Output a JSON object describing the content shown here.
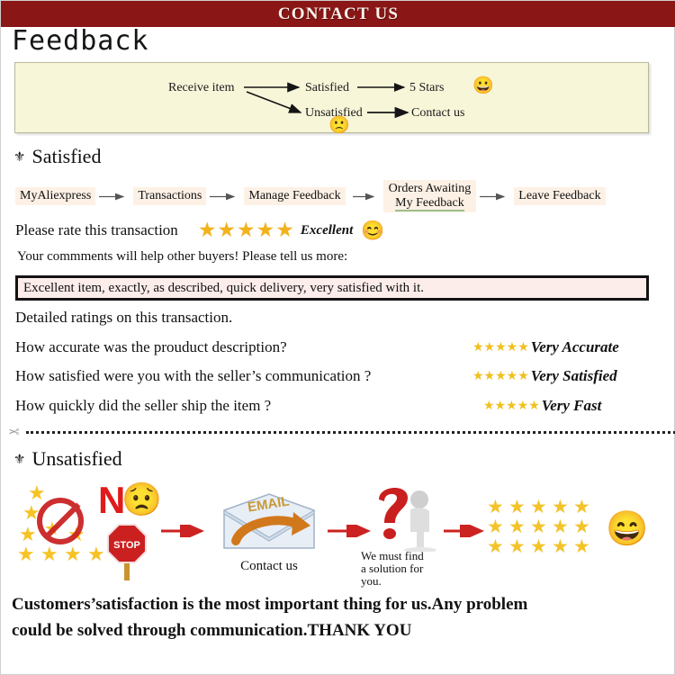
{
  "banner": {
    "title": "CONTACT US"
  },
  "heading": {
    "feedback": "Feedback"
  },
  "flow": {
    "receive_item": "Receive item",
    "satisfied": "Satisfied",
    "five_stars": "5 Stars",
    "unsatisfied": "Unsatisfied",
    "contact_us": "Contact us",
    "happy_face": "😀",
    "sad_face": "🙁"
  },
  "satisfied": {
    "bullet": "⚜",
    "title": "Satisfied",
    "crumbs": [
      {
        "label": "MyAliexpress"
      },
      {
        "label": "Transactions"
      },
      {
        "label": "Manage Feedback"
      },
      {
        "line1": "Orders Awaiting",
        "line2": "My Feedback"
      },
      {
        "label": "Leave Feedback"
      }
    ],
    "rate_label": "Please rate this transaction",
    "rate_stars": "★★★★★",
    "rate_word": "Excellent",
    "rate_emoji": "😊",
    "comments_prompt": "Your commments will help other buyers!  Please tell us more:",
    "comment_value": "Excellent item, exactly, as described, quick delivery, very satisfied with it.",
    "detailed_lead": "Detailed ratings on this transaction.",
    "questions": [
      {
        "question": "How accurate was the prouduct description?",
        "stars": "★★★★★",
        "rating_label": "Very Accurate"
      },
      {
        "question": "How satisfied were you with the seller’s communication ?",
        "stars": "★★★★★",
        "rating_label": "Very Satisfied"
      },
      {
        "question": "How quickly did the seller ship the item ?",
        "stars": "★★★★★",
        "rating_label": "Very Fast"
      }
    ]
  },
  "divider": {
    "scissors": "✂"
  },
  "unsatisfied": {
    "bullet": "⚜",
    "title": "Unsatisfied",
    "no_letter": "N",
    "sad_face": "😟",
    "stop_label": "STOP",
    "email_label": "EMAIL",
    "contact_caption": "Contact us",
    "solution_caption_line1": "We must find",
    "solution_caption_line2": "a solution for",
    "solution_caption_line3": "you.",
    "happy_face": "😄"
  },
  "footer": {
    "line1": "Customers’satisfaction is the most important thing for us.Any problem",
    "line2": "could be solved through communication.THANK YOU"
  },
  "colors": {
    "banner_bg": "#8A1616",
    "flowbox_bg": "#F8F6D9",
    "chip_bg": "#FDF1E6",
    "comment_bg": "#FCEDEB",
    "star_gold": "#F2B21C",
    "arrow_red": "#CC2222"
  }
}
